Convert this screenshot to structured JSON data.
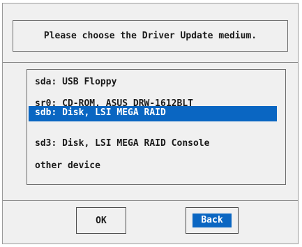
{
  "dialog": {
    "prompt": "Please choose the Driver Update medium.",
    "items": [
      {
        "label": "sda: USB Floppy"
      },
      {
        "label": "sr0: CD-ROM, ASUS DRW-1612BLT"
      },
      {
        "label": "sdb: Disk, LSI MEGA RAID",
        "selected": true
      },
      {
        "label": "sd3: Disk, LSI MEGA RAID Console"
      },
      {
        "label": "other device"
      }
    ],
    "ok_label": "OK",
    "back_label": "Back",
    "focused_button": "Back"
  },
  "colors": {
    "selection": "#0a66c2",
    "background": "#f0f0f0",
    "text": "#1a1a1a"
  }
}
